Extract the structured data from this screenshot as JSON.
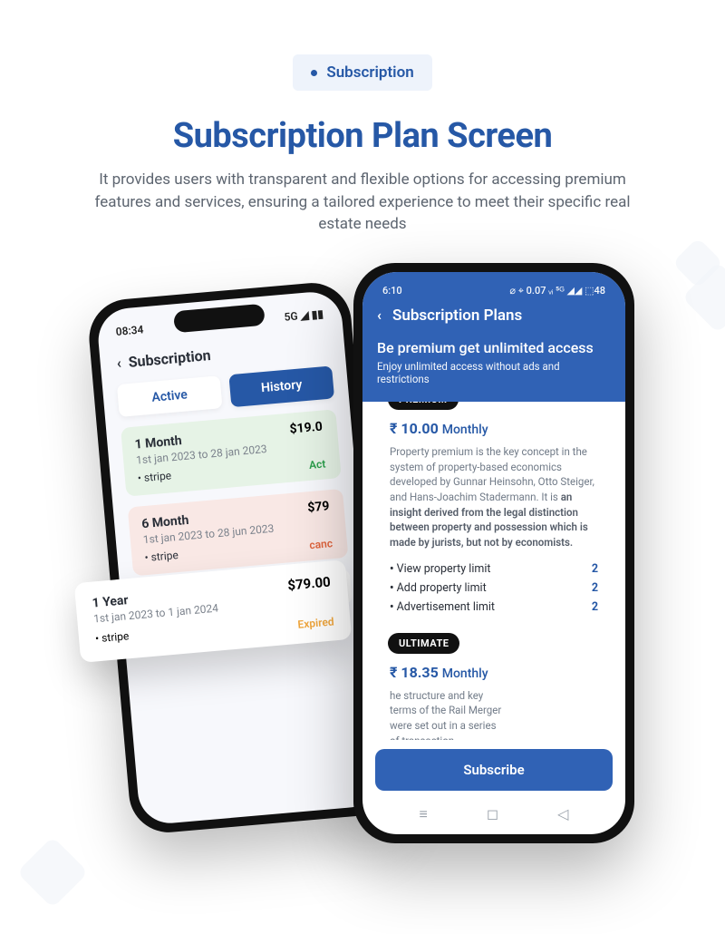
{
  "chip": {
    "label": "Subscription"
  },
  "headline": "Subscription Plan Screen",
  "sub": "It provides users with transparent and flexible options for accessing premium features and services, ensuring a tailored experience to meet their specific real estate needs",
  "phone1": {
    "time": "08:34",
    "signal": "5G",
    "title": "Subscription",
    "tabs": {
      "active": "Active",
      "history": "History"
    },
    "cards": {
      "month1": {
        "title": "1 Month",
        "dates": "1st jan 2023  to 28 jan 2023",
        "method": "stripe",
        "price": "$19.0",
        "status": "Act"
      },
      "month6": {
        "title": "6 Month",
        "dates": "1st jan 2023  to 28 jun 2023",
        "method": "stripe",
        "price": "$79",
        "status": "canc"
      },
      "year1_bg": {
        "title": "1 Year",
        "price": "$7"
      }
    }
  },
  "floating": {
    "title": "1 Year",
    "dates": "1st jan 2023  to 1 jan 2024",
    "method": "stripe",
    "price": "$79.00",
    "status": "Expired"
  },
  "phone2": {
    "status": {
      "time": "6:10",
      "right": "⌀ ⌖ 0.07 ᵥᵢ  ⁵ᴳ ◢◢ ⬚48"
    },
    "title": "Subscription Plans",
    "big": "Be premium get unlimited access",
    "sub": "Enjoy unlimited access without ads and restrictions",
    "plans": {
      "premium": {
        "badge": "PREMIUM",
        "price_num": "₹ 10.00",
        "price_per": "Monthly",
        "desc_plain": "Property premium is the key concept in the system of property-based economics developed by Gunnar Heinsohn, Otto Steiger, and Hans-Joachim Stadermann. It is ",
        "desc_bold": "an insight derived from the legal distinction between property and possession which is made by jurists, but not by economists.",
        "limits": [
          {
            "label": "View property limit",
            "value": "2"
          },
          {
            "label": "Add property limit",
            "value": "2"
          },
          {
            "label": "Advertisement limit",
            "value": "2"
          }
        ]
      },
      "ultimate": {
        "badge": "ULTIMATE",
        "price_num": "₹ 18.35",
        "price_per": "Monthly",
        "desc": "he structure and key terms of the Rail Merger were set out in a series of transaction agreements entered into between, inter"
      }
    },
    "subscribe": "Subscribe",
    "nav": {
      "menu": "≡",
      "home": "◻",
      "back": "◁"
    }
  }
}
